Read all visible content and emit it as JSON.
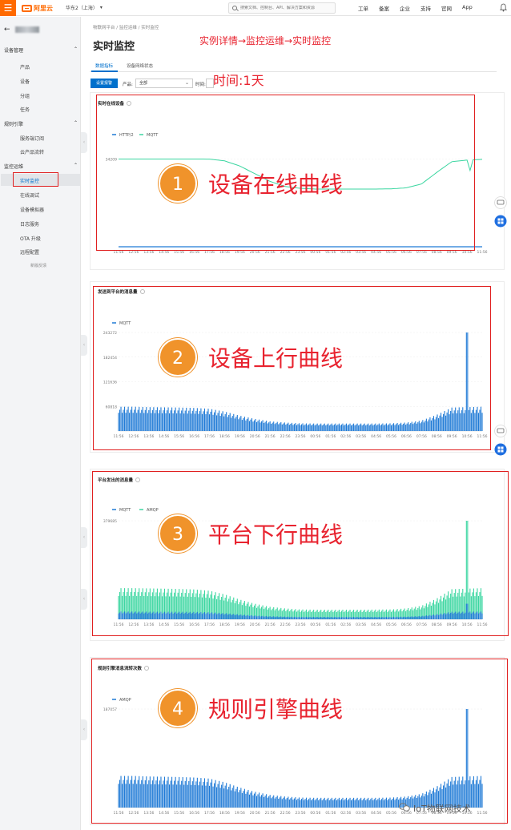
{
  "topbar": {
    "menu_icon": "hamburger-icon",
    "logo_text": "阿里云",
    "region": "华东2（上海）",
    "region_arrow": "▾",
    "search_placeholder": "搜索文档、控制台、API、解决方案和资源",
    "nav": [
      "工单",
      "备案",
      "企业",
      "支持",
      "官网",
      "App"
    ]
  },
  "sidebar": {
    "back_arrow": "←",
    "groups": [
      {
        "label": "设备管理",
        "items": [
          "产品",
          "设备",
          "分组",
          "任务"
        ]
      },
      {
        "label": "规则引擎",
        "items": [
          "服务端订阅",
          "云产品流转"
        ]
      },
      {
        "label": "监控运维",
        "items": [
          "实时监控",
          "在线调试",
          "设备模拟器",
          "日志服务",
          "OTA 升级",
          "远程配置"
        ]
      }
    ],
    "active_item": "实时监控",
    "feedback": "新版反馈"
  },
  "breadcrumb": [
    "物联网平台",
    "监控运维",
    "实时监控"
  ],
  "page_title": "实时监控",
  "annotation_path": "实例详情→监控运维→实时监控",
  "annotation_time": "时间:1天",
  "tabs": [
    "数据指标",
    "设备网络状态"
  ],
  "filter": {
    "button": "设置报警",
    "product_label": "产品:",
    "product_value": "全部",
    "time_label": "时间:"
  },
  "x_ticks": [
    "11:56",
    "12:56",
    "13:56",
    "14:56",
    "15:56",
    "16:56",
    "17:56",
    "18:56",
    "19:56",
    "20:56",
    "21:56",
    "22:56",
    "23:56",
    "00:56",
    "01:56",
    "02:56",
    "03:56",
    "04:56",
    "05:56",
    "06:56",
    "07:56",
    "08:56",
    "09:56",
    "10:56",
    "11:56"
  ],
  "colors": {
    "blue": "#1f7ad6",
    "teal": "#3ad6a0",
    "red": "#e02020",
    "orange": "#f0932b",
    "primary": "#0070cc"
  },
  "cards": [
    {
      "title": "实时在线设备",
      "badge": "1",
      "label": "设备在线曲线",
      "legend": [
        "HTTP/2",
        "MQTT"
      ],
      "yticks": [
        "34209"
      ]
    },
    {
      "title": "发送到平台的消息量",
      "badge": "2",
      "label": "设备上行曲线",
      "legend": [
        "MQTT"
      ],
      "yticks": [
        "243272",
        "182454",
        "121636",
        "60818"
      ]
    },
    {
      "title": "平台发出的消息量",
      "badge": "3",
      "label": "平台下行曲线",
      "legend": [
        "MQTT",
        "AMQP"
      ],
      "yticks": [
        "379685"
      ]
    },
    {
      "title": "规则引擎消息流转次数",
      "badge": "4",
      "label": "规则引擎曲线",
      "legend": [
        "AMQP"
      ],
      "yticks": [
        "187057"
      ]
    }
  ],
  "chart_data": [
    {
      "type": "line",
      "title": "实时在线设备",
      "x": [
        "11:56",
        "12:56",
        "13:56",
        "14:56",
        "15:56",
        "16:56",
        "17:56",
        "18:56",
        "19:56",
        "20:56",
        "21:56",
        "22:56",
        "23:56",
        "00:56",
        "01:56",
        "02:56",
        "03:56",
        "04:56",
        "05:56",
        "06:56",
        "07:56",
        "08:56",
        "09:56",
        "10:56",
        "11:56"
      ],
      "series": [
        {
          "name": "MQTT",
          "values": [
            34209,
            34209,
            34209,
            34209,
            34209,
            34209,
            34200,
            33500,
            31500,
            28500,
            25500,
            23500,
            22800,
            22500,
            22500,
            22500,
            22500,
            22500,
            22600,
            23000,
            24500,
            29000,
            33200,
            33800,
            34100
          ]
        },
        {
          "name": "HTTP/2",
          "values": [
            0,
            0,
            0,
            0,
            0,
            0,
            0,
            0,
            0,
            0,
            0,
            0,
            0,
            0,
            0,
            0,
            0,
            0,
            0,
            0,
            0,
            0,
            0,
            0,
            0
          ]
        }
      ],
      "yticks": [
        34209
      ]
    },
    {
      "type": "area",
      "title": "发送到平台的消息量",
      "x": [
        "11:56",
        "12:56",
        "13:56",
        "14:56",
        "15:56",
        "16:56",
        "17:56",
        "18:56",
        "19:56",
        "20:56",
        "21:56",
        "22:56",
        "23:56",
        "00:56",
        "01:56",
        "02:56",
        "03:56",
        "04:56",
        "05:56",
        "06:56",
        "07:56",
        "08:56",
        "09:56",
        "10:56",
        "11:56"
      ],
      "series": [
        {
          "name": "MQTT",
          "values": [
            60000,
            60000,
            59000,
            58500,
            58000,
            57000,
            55000,
            48000,
            38000,
            30000,
            24000,
            21000,
            19000,
            18500,
            18500,
            18500,
            18500,
            18500,
            19000,
            21000,
            26000,
            40000,
            58000,
            243272,
            60000
          ]
        }
      ],
      "yticks": [
        60818,
        121636,
        182454,
        243272
      ]
    },
    {
      "type": "area",
      "title": "平台发出的消息量",
      "x": [
        "11:56",
        "12:56",
        "13:56",
        "14:56",
        "15:56",
        "16:56",
        "17:56",
        "18:56",
        "19:56",
        "20:56",
        "21:56",
        "22:56",
        "23:56",
        "00:56",
        "01:56",
        "02:56",
        "03:56",
        "04:56",
        "05:56",
        "06:56",
        "07:56",
        "08:56",
        "09:56",
        "10:56",
        "11:56"
      ],
      "series": [
        {
          "name": "AMQP",
          "values": [
            120000,
            120000,
            119000,
            118000,
            117000,
            115000,
            110000,
            96000,
            76000,
            60000,
            48000,
            42000,
            38000,
            37000,
            37000,
            37000,
            37000,
            37500,
            38000,
            42000,
            52000,
            80000,
            116000,
            379685,
            120000
          ]
        },
        {
          "name": "MQTT",
          "values": [
            30000,
            30000,
            29500,
            29000,
            29000,
            28500,
            27500,
            24000,
            19000,
            15000,
            12000,
            10500,
            9500,
            9300,
            9300,
            9300,
            9300,
            9300,
            9500,
            10500,
            13000,
            20000,
            29000,
            60000,
            30000
          ]
        }
      ],
      "yticks": [
        379685
      ]
    },
    {
      "type": "area",
      "title": "规则引擎消息流转次数",
      "x": [
        "11:56",
        "12:56",
        "13:56",
        "14:56",
        "15:56",
        "16:56",
        "17:56",
        "18:56",
        "19:56",
        "20:56",
        "21:56",
        "22:56",
        "23:56",
        "00:56",
        "01:56",
        "02:56",
        "03:56",
        "04:56",
        "05:56",
        "06:56",
        "07:56",
        "08:56",
        "09:56",
        "10:56",
        "11:56"
      ],
      "series": [
        {
          "name": "AMQP",
          "values": [
            60000,
            60000,
            59000,
            58500,
            58000,
            57000,
            55000,
            48000,
            38000,
            30000,
            24000,
            21000,
            19000,
            18500,
            18500,
            18500,
            18500,
            18500,
            19000,
            21000,
            26000,
            40000,
            58000,
            187057,
            60000
          ]
        }
      ],
      "yticks": [
        187057
      ]
    }
  ],
  "watermark": "IoT物联网技术"
}
